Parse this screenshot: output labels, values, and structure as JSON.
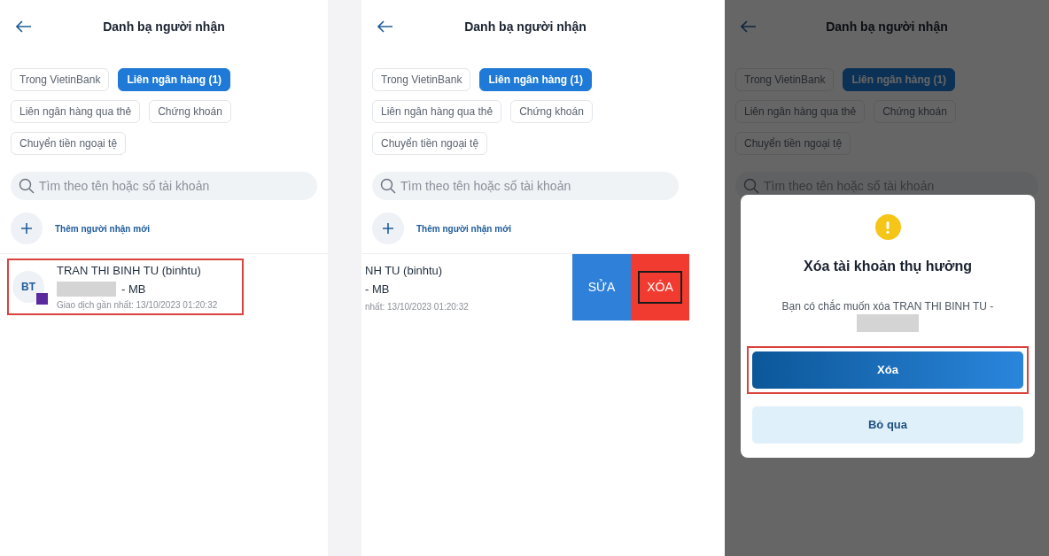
{
  "screens": [
    {
      "title": "Danh bạ người nhận",
      "tabs": [
        {
          "label": "Trong VietinBank",
          "selected": false
        },
        {
          "label": "Liên ngân hàng (1)",
          "selected": true
        },
        {
          "label": "Liên ngân hàng qua thẻ",
          "selected": false
        },
        {
          "label": "Chứng khoán",
          "selected": false
        },
        {
          "label": "Chuyển tiền ngoại tệ",
          "selected": false
        }
      ],
      "search": {
        "placeholder": "Tìm theo tên hoặc số tài khoản"
      },
      "add_recipient": "Thêm người nhận mới",
      "contact": {
        "kind": "normal",
        "avatar": "BT",
        "name": "TRAN THI BINH TU (binhtu)",
        "account_redacted": true,
        "bank": "- MB",
        "last_transaction": "Giao dịch gần nhất: 13/10/2023 01:20:32",
        "highlighted": true
      }
    },
    {
      "title": "Danh bạ người nhận",
      "tabs": [
        {
          "label": "Trong VietinBank",
          "selected": false
        },
        {
          "label": "Liên ngân hàng (1)",
          "selected": true
        },
        {
          "label": "Liên ngân hàng qua thẻ",
          "selected": false
        },
        {
          "label": "Chứng khoán",
          "selected": false
        },
        {
          "label": "Chuyển tiền ngoại tệ",
          "selected": false
        }
      ],
      "search": {
        "placeholder": "Tìm theo tên hoặc số tài khoản"
      },
      "add_recipient": "Thêm người nhận mới",
      "contact": {
        "kind": "swiped",
        "name": "NH TU (binhtu)",
        "bank": "- MB",
        "last_transaction": "nhất: 13/10/2023 01:20:32",
        "actions": [
          {
            "label": "SỬA",
            "kind": "edit",
            "highlighted": false
          },
          {
            "label": "XÓA",
            "kind": "delete",
            "highlighted": true
          }
        ]
      }
    },
    {
      "title": "Danh bạ người nhận",
      "dimmed": true,
      "tabs": [
        {
          "label": "Trong VietinBank",
          "selected": false
        },
        {
          "label": "Liên ngân hàng (1)",
          "selected": true
        },
        {
          "label": "Liên ngân hàng qua thẻ",
          "selected": false
        },
        {
          "label": "Chứng khoán",
          "selected": false
        },
        {
          "label": "Chuyển tiền ngoại tệ",
          "selected": false
        }
      ],
      "search": {
        "placeholder": "Tìm theo tên hoặc số tài khoản"
      },
      "dialog": {
        "title": "Xóa tài khoản thụ hưởng",
        "message": "Bạn có chắc muốn xóa TRAN THI BINH TU -",
        "account_redacted": true,
        "buttons": [
          {
            "label": "Xóa",
            "kind": "primary",
            "highlighted": true
          },
          {
            "label": "Bỏ qua",
            "kind": "secondary",
            "highlighted": false
          }
        ]
      }
    }
  ]
}
